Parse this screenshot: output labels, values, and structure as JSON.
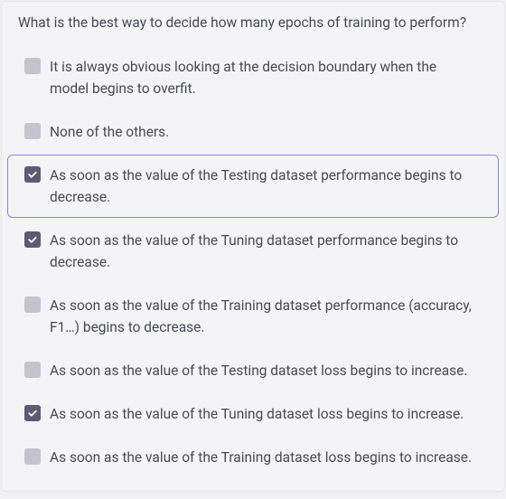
{
  "question": "What is the best way to decide how many epochs of training to perform?",
  "options": [
    {
      "label": "It is always obvious looking at the decision boundary when the model begins to overfit.",
      "checked": false,
      "focused": false
    },
    {
      "label": "None of the others.",
      "checked": false,
      "focused": false
    },
    {
      "label": "As soon as the value of the Testing dataset performance begins to decrease.",
      "checked": true,
      "focused": true
    },
    {
      "label": "As soon as the value of the Tuning dataset performance begins to decrease.",
      "checked": true,
      "focused": false
    },
    {
      "label": "As soon as the value of the Training dataset performance (accuracy, F1…) begins to decrease.",
      "checked": false,
      "focused": false
    },
    {
      "label": "As soon as the value of the Testing dataset loss begins to increase.",
      "checked": false,
      "focused": false
    },
    {
      "label": "As soon as the value of the Tuning dataset loss begins to increase.",
      "checked": true,
      "focused": false
    },
    {
      "label": "As soon as the value of the Training dataset loss begins to increase.",
      "checked": false,
      "focused": false
    }
  ]
}
